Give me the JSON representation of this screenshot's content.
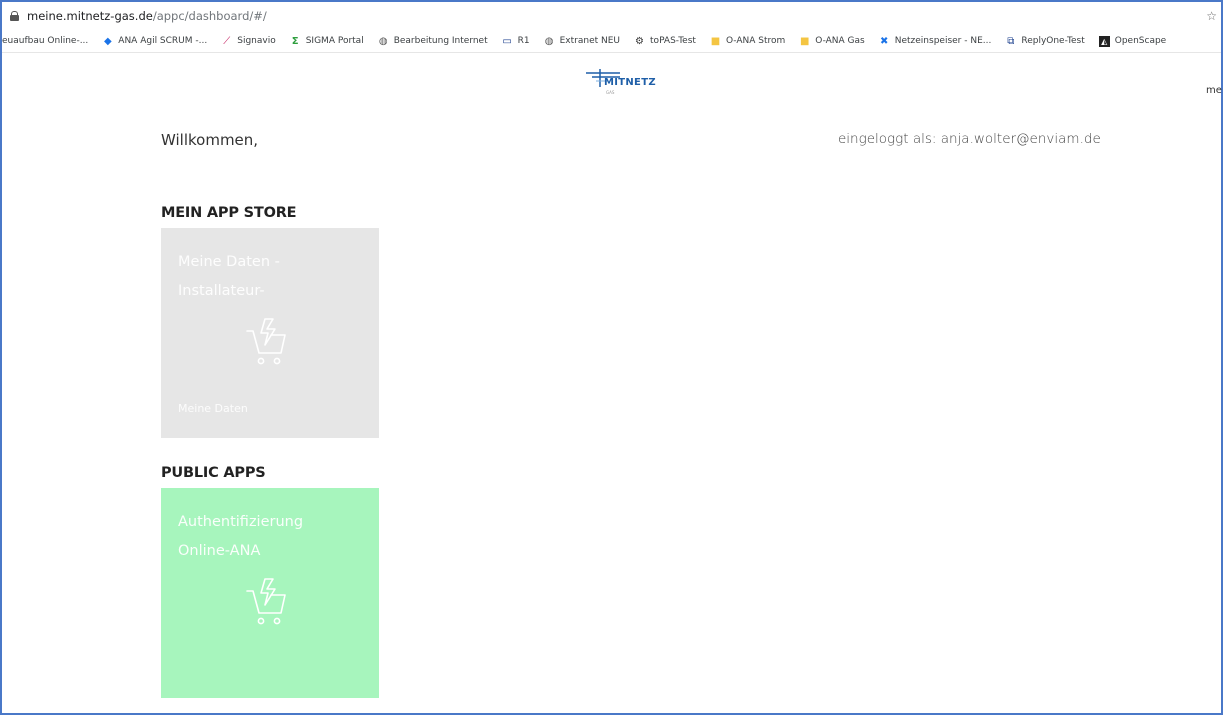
{
  "browser": {
    "url_host": "meine.mitnetz-gas.de",
    "url_path": "/appc/dashboard/#/"
  },
  "bookmarks": [
    {
      "label": "euaufbau Online-...",
      "icon": "bookmark-generic-icon",
      "color": "#999999"
    },
    {
      "label": "ANA Agil SCRUM -...",
      "icon": "diamond-icon",
      "color": "#1a73e8"
    },
    {
      "label": "Signavio",
      "icon": "signavio-icon",
      "color": "#c2185b"
    },
    {
      "label": "SIGMA Portal",
      "icon": "sigma-icon",
      "color": "#2e9e3e"
    },
    {
      "label": "Bearbeitung Internet",
      "icon": "globe-icon",
      "color": "#555555"
    },
    {
      "label": "R1",
      "icon": "computer-icon",
      "color": "#1a3e8c"
    },
    {
      "label": "Extranet NEU",
      "icon": "globe-icon",
      "color": "#555555"
    },
    {
      "label": "toPAS-Test",
      "icon": "gears-icon",
      "color": "#333333"
    },
    {
      "label": "O-ANA Strom",
      "icon": "folder-icon",
      "color": "#f4c542"
    },
    {
      "label": "O-ANA Gas",
      "icon": "folder-icon",
      "color": "#f4c542"
    },
    {
      "label": "Netzeinspeiser - NE...",
      "icon": "cross-icon",
      "color": "#1a73e8"
    },
    {
      "label": "ReplyOne-Test",
      "icon": "reply-icon",
      "color": "#1a3e8c"
    },
    {
      "label": "OpenScape",
      "icon": "openscape-icon",
      "color": "#222222"
    }
  ],
  "logo": {
    "brand": "MITNETZ",
    "sub": "GAS"
  },
  "corner_text": "me",
  "welcome": "Willkommen,",
  "login_text": "eingeloggt als: anja.wolter@enviam.de",
  "sections": {
    "my_apps_title": "MEIN APP STORE",
    "public_apps_title": "PUBLIC APPS"
  },
  "tiles": {
    "my_data": {
      "title_line1": "Meine Daten -",
      "title_line2": "Installateur-",
      "footer": "Meine Daten",
      "color": "#e6e6e6"
    },
    "auth": {
      "title_line1": "Authentifizierung",
      "title_line2": "Online-ANA",
      "footer": "",
      "color": "#a7f5bd"
    }
  }
}
